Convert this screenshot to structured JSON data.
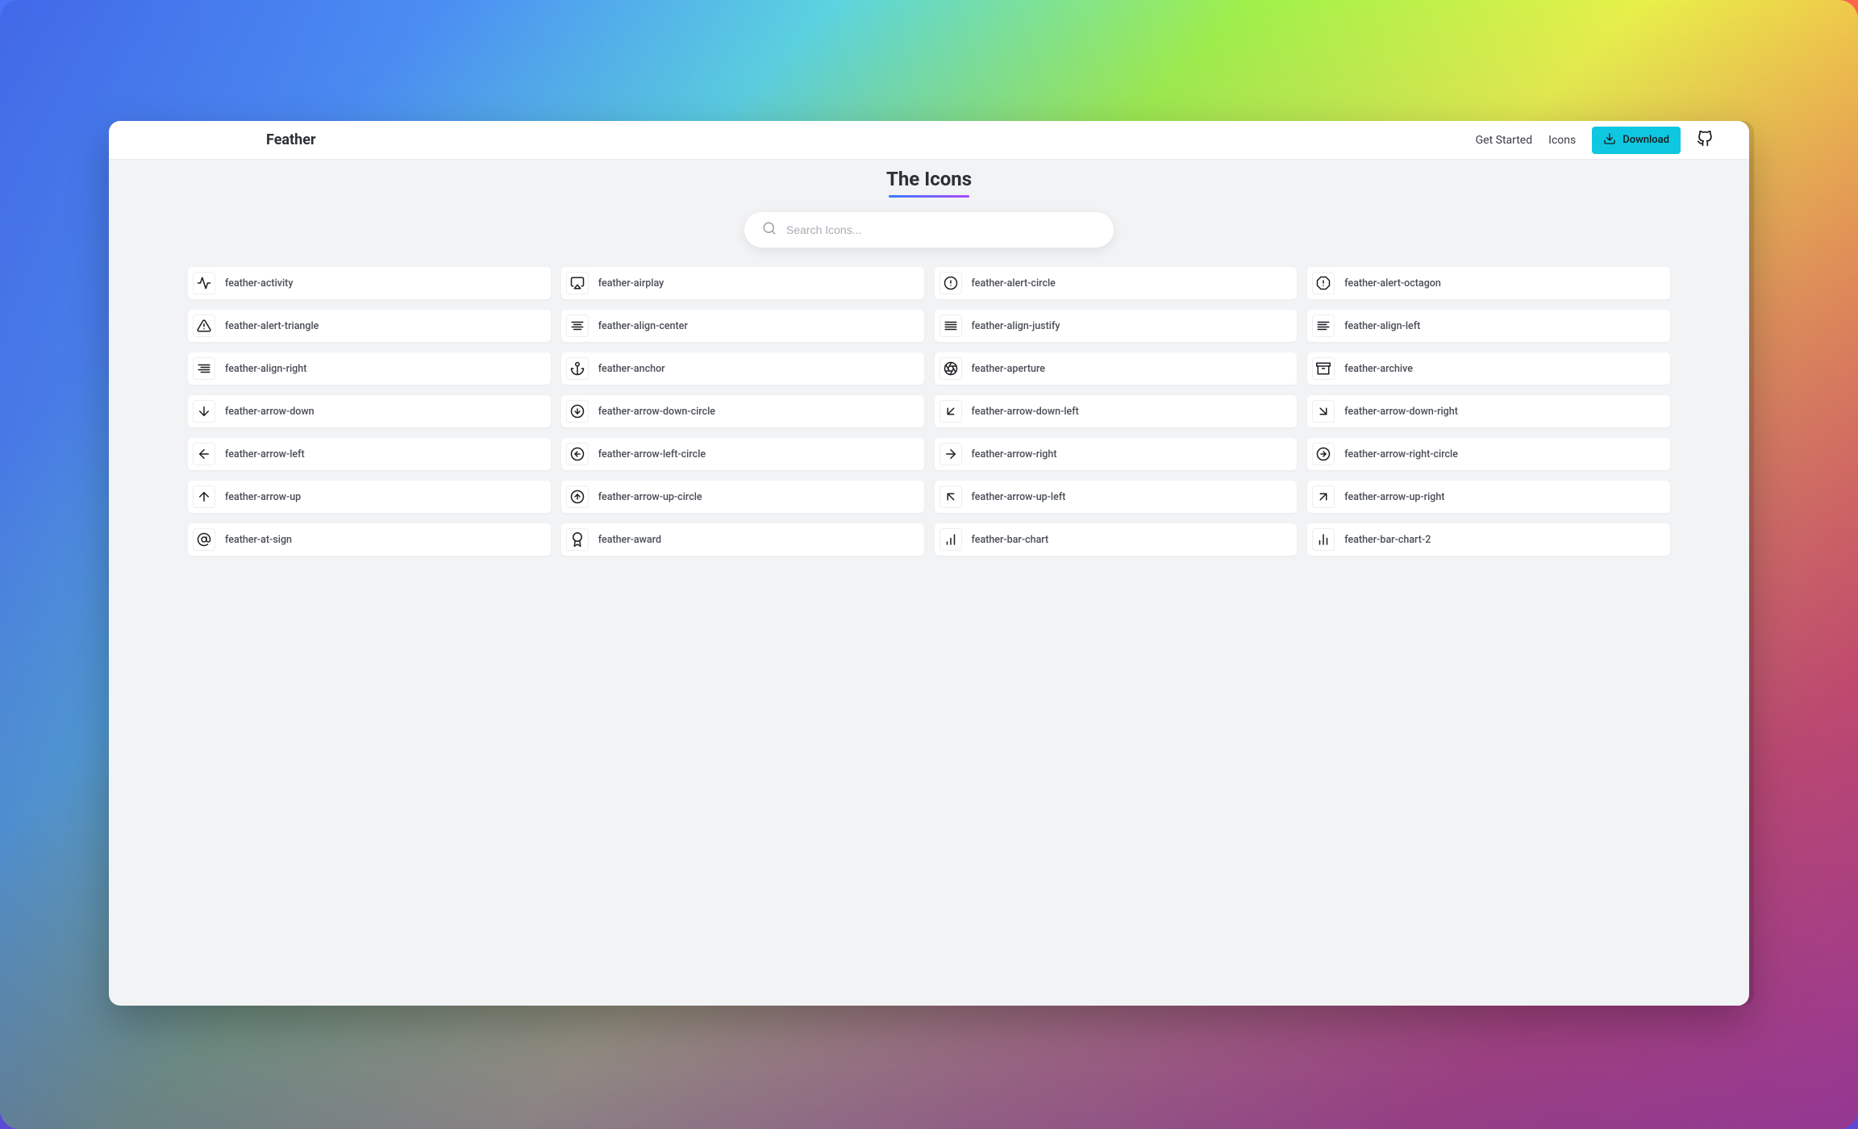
{
  "brand": "Feather",
  "nav": {
    "get_started": "Get Started",
    "icons": "Icons",
    "download": "Download"
  },
  "title": "The Icons",
  "search": {
    "placeholder": "Search Icons..."
  },
  "icons": [
    {
      "name": "feather-activity"
    },
    {
      "name": "feather-airplay"
    },
    {
      "name": "feather-alert-circle"
    },
    {
      "name": "feather-alert-octagon"
    },
    {
      "name": "feather-alert-triangle"
    },
    {
      "name": "feather-align-center"
    },
    {
      "name": "feather-align-justify"
    },
    {
      "name": "feather-align-left"
    },
    {
      "name": "feather-align-right"
    },
    {
      "name": "feather-anchor"
    },
    {
      "name": "feather-aperture"
    },
    {
      "name": "feather-archive"
    },
    {
      "name": "feather-arrow-down"
    },
    {
      "name": "feather-arrow-down-circle"
    },
    {
      "name": "feather-arrow-down-left"
    },
    {
      "name": "feather-arrow-down-right"
    },
    {
      "name": "feather-arrow-left"
    },
    {
      "name": "feather-arrow-left-circle"
    },
    {
      "name": "feather-arrow-right"
    },
    {
      "name": "feather-arrow-right-circle"
    },
    {
      "name": "feather-arrow-up"
    },
    {
      "name": "feather-arrow-up-circle"
    },
    {
      "name": "feather-arrow-up-left"
    },
    {
      "name": "feather-arrow-up-right"
    },
    {
      "name": "feather-at-sign"
    },
    {
      "name": "feather-award"
    },
    {
      "name": "feather-bar-chart"
    },
    {
      "name": "feather-bar-chart-2"
    }
  ]
}
